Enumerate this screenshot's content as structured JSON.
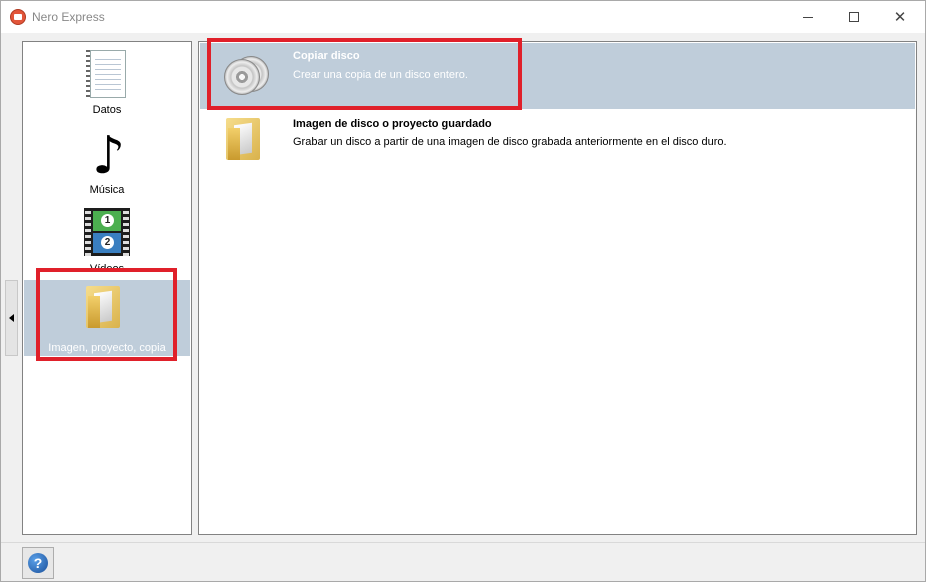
{
  "window": {
    "title": "Nero Express"
  },
  "categories": [
    {
      "label": "Datos",
      "icon": "document-icon"
    },
    {
      "label": "Música",
      "icon": "music-note-icon"
    },
    {
      "label": "Vídeos",
      "icon": "film-strip-icon"
    },
    {
      "label": "Imagen, proyecto, copia",
      "icon": "folder-icon",
      "selected": true
    }
  ],
  "tasks": [
    {
      "title": "Copiar disco",
      "description": "Crear una copia de un disco entero.",
      "icon": "cd-copy-icon",
      "selected": true
    },
    {
      "title": "Imagen de disco o proyecto guardado",
      "description": "Grabar un disco a partir de una imagen de disco grabada anteriormente en el disco duro.",
      "icon": "folder-icon",
      "selected": false
    }
  ],
  "film_numbers": [
    "1",
    "2"
  ],
  "help": {
    "glyph": "?"
  },
  "colors": {
    "selection": "#bfcdda",
    "highlight": "#e0202a"
  }
}
